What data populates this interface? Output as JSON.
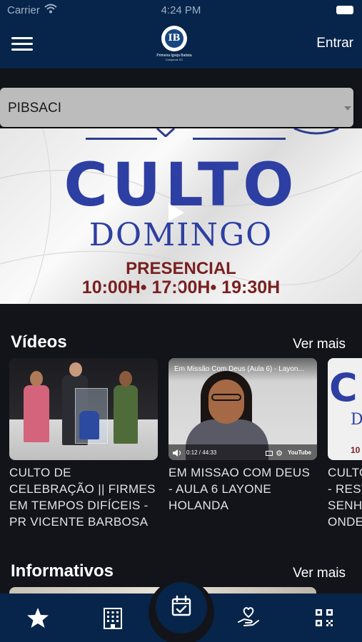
{
  "status_bar": {
    "carrier": "Carrier",
    "time": "4:24 PM"
  },
  "header": {
    "logo_name": "Primeira Igreja Batista",
    "logo_sub": "Campinas SC",
    "login_label": "Entrar"
  },
  "church_selector": {
    "selected": "PIBSACI"
  },
  "banner": {
    "title": "CULTO",
    "subtitle": "DOMINGO",
    "mode": "PRESENCIAL",
    "times": "10:00H• 17:00H• 19:30H"
  },
  "videos": {
    "title": "Vídeos",
    "more_label": "Ver mais",
    "items": [
      {
        "title": "CULTO DE CELEBRAÇÃO || FIRMES EM TEMPOS DIFÍCEIS - PR VICENTE BARBOSA"
      },
      {
        "title": "EM MISSAO COM DEUS - AULA 6 LAYONE HOLANDA",
        "overlay_title": "Em Missão Com Deus (Aula 6) - Layon...",
        "player_time": "0:12 / 44:33",
        "player_brand": "YouTube"
      },
      {
        "title": "CULTO - REST SENHO ONDE",
        "thumb_title": "CULT",
        "thumb_sub": "D",
        "thumb_times": "10"
      }
    ]
  },
  "informativos": {
    "title": "Informativos",
    "more_label": "Ver mais"
  },
  "tab_bar": {
    "items": [
      "star-icon",
      "building-icon",
      "calendar-check-icon",
      "donation-heart-icon",
      "qr-code-icon"
    ]
  },
  "colors": {
    "navy": "#07254a",
    "background": "#12141a",
    "banner_blue": "#2d3fa2",
    "banner_red": "#7a1f1f"
  }
}
